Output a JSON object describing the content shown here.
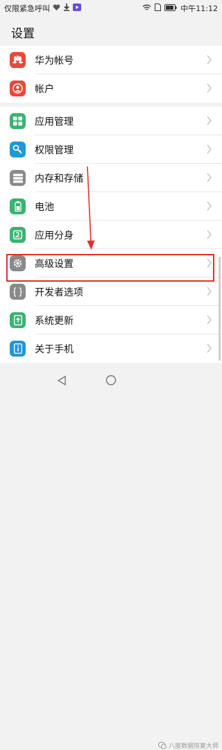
{
  "status_bar": {
    "carrier_text": "仅限紧急呼叫",
    "time": "中午11:12",
    "icons": [
      "heart-icon",
      "download-icon",
      "video-icon",
      "wifi-icon",
      "sim-icon",
      "battery-icon"
    ]
  },
  "header": {
    "title": "设置"
  },
  "groups": [
    {
      "items": [
        {
          "label": "华为帐号",
          "icon": "huawei-icon",
          "color": "#e64a3a"
        },
        {
          "label": "帐户",
          "icon": "account-icon",
          "color": "#e64a3a"
        }
      ]
    },
    {
      "items": [
        {
          "label": "应用管理",
          "icon": "apps-icon",
          "color": "#3cb371"
        },
        {
          "label": "权限管理",
          "icon": "key-icon",
          "color": "#2196d9"
        },
        {
          "label": "内存和存储",
          "icon": "storage-icon",
          "color": "#8a8a8a"
        },
        {
          "label": "电池",
          "icon": "battery-icon",
          "color": "#3cb371"
        },
        {
          "label": "应用分身",
          "icon": "app-twin-icon",
          "color": "#3cb371"
        },
        {
          "label": "高级设置",
          "icon": "gear-icon",
          "color": "#8a8a8a"
        },
        {
          "label": "开发者选项",
          "icon": "braces-icon",
          "color": "#8a8a8a"
        },
        {
          "label": "系统更新",
          "icon": "update-icon",
          "color": "#3cb371"
        },
        {
          "label": "关于手机",
          "icon": "info-icon",
          "color": "#2196d9"
        }
      ]
    }
  ],
  "annotation": {
    "highlighted_item": "高级设置",
    "highlight_color": "#e0302a"
  },
  "watermark": "八度数据恢复大师"
}
